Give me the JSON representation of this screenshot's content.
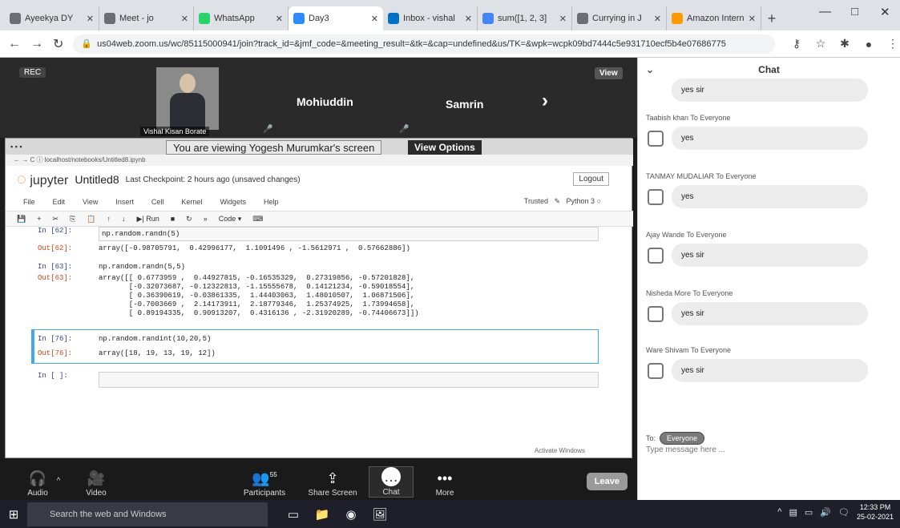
{
  "browser": {
    "tabs": [
      {
        "title": "Ayeekya DY",
        "active": false
      },
      {
        "title": "Meet - jo",
        "active": false
      },
      {
        "title": "WhatsApp",
        "active": false
      },
      {
        "title": "Day3",
        "active": true
      },
      {
        "title": "Inbox - vishal",
        "active": false
      },
      {
        "title": "sum([1, 2, 3]",
        "active": false
      },
      {
        "title": "Currying in J",
        "active": false
      },
      {
        "title": "Amazon Intern",
        "active": false
      }
    ],
    "url": "us04web.zoom.us/wc/85115000941/join?track_id=&jmf_code=&meeting_result=&tk=&cap=undefined&us/TK=&wpk=wcpk09bd7444c5e931710ecf5b4e07686775"
  },
  "zoom": {
    "rec_label": "REC",
    "view_label": "View",
    "participants_strip": {
      "video_tile_name": "Vishal Kisan Borate",
      "tile_names": [
        "Mohiuddin",
        "Samrin"
      ]
    },
    "share_banner": "You are viewing Yogesh Murumkar's screen",
    "view_options": "View Options",
    "controls": {
      "audio": "Audio",
      "video": "Video",
      "participants": "Participants",
      "participants_count": "55",
      "share_screen": "Share Screen",
      "chat": "Chat",
      "more": "More",
      "leave": "Leave"
    }
  },
  "jupyter": {
    "logo_text": "jupyter",
    "notebook_name": "Untitled8",
    "checkpoint": "Last Checkpoint: 2 hours ago (unsaved changes)",
    "logout": "Logout",
    "menu": [
      "File",
      "Edit",
      "View",
      "Insert",
      "Cell",
      "Kernel",
      "Widgets",
      "Help"
    ],
    "trusted": "Trusted",
    "kernel": "Python 3",
    "toolbar_run": "Run",
    "toolbar_celltype": "Code",
    "cells": [
      {
        "in_prompt": "In [62]:",
        "code": "np.random.randn(5)",
        "out_prompt": "Out[62]:",
        "output": "array([-0.98705791,  0.42996177,  1.1091496 , -1.5612971 ,  0.57662886])"
      },
      {
        "in_prompt": "In [63]:",
        "code": "np.random.randn(5,5)",
        "out_prompt": "Out[63]:",
        "output": "array([[ 0.6773959 ,  0.44927815, -0.16535329,  0.27319856, -0.57201828],\n       [-0.32073687, -0.12322813, -1.15555678,  0.14121234, -0.59018554],\n       [ 0.36390619, -0.03861335,  1.44403063,  1.48010507,  1.06871506],\n       [-0.7003669 ,  2.14173911,  2.18779346,  1.25374925,  1.73994658],\n       [ 0.89194335,  0.90913207,  0.4316136 , -2.31920289, -0.74406673]])"
      },
      {
        "in_prompt": "In [76]:",
        "code": "np.random.randint(10,20,5)",
        "out_prompt": "Out[76]:",
        "output": "array([18, 19, 13, 19, 12])"
      },
      {
        "in_prompt": "In [ ]:",
        "code": "",
        "out_prompt": "",
        "output": ""
      }
    ],
    "status_right": "Activate Windows"
  },
  "chat": {
    "title": "Chat",
    "messages": [
      {
        "sender": "",
        "text": "yes sir"
      },
      {
        "sender": "Taabish khan To Everyone",
        "text": "yes"
      },
      {
        "sender": "TANMAY MUDALIAR To Everyone",
        "text": "yes"
      },
      {
        "sender": "Ajay Wande To Everyone",
        "text": "yes sir"
      },
      {
        "sender": "Nisheda More To Everyone",
        "text": "yes sir"
      },
      {
        "sender": "Ware Shivam To Everyone",
        "text": "yes sir"
      }
    ],
    "to_label": "To:",
    "to_target": "Everyone",
    "input_placeholder": "Type message here ..."
  },
  "taskbar": {
    "search_placeholder": "Search the web and Windows",
    "time": "12:33 PM",
    "date": "25-02-2021"
  }
}
